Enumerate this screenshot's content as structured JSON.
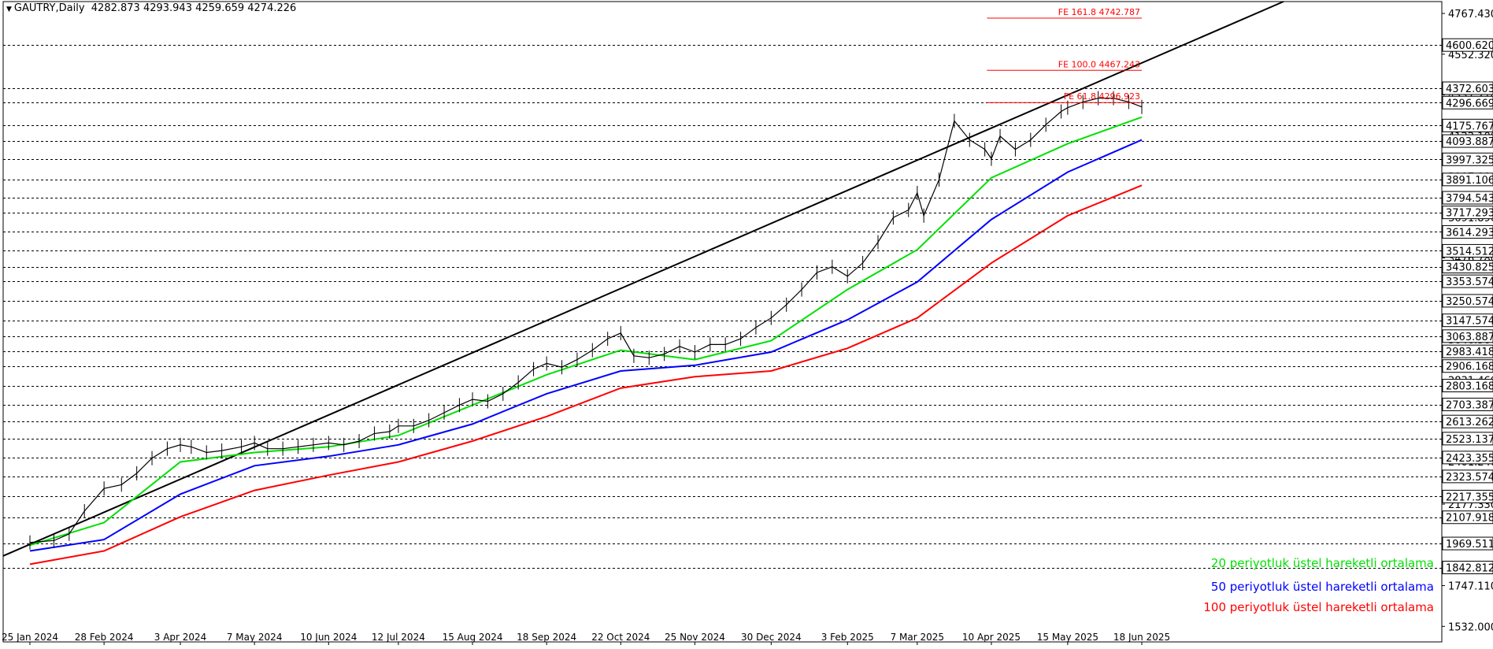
{
  "header": {
    "symbol": "GAUTRY,Daily",
    "ohlc": "4282.873 4293.943 4259.659 4274.226"
  },
  "chart_data": {
    "type": "line",
    "title": "GAUTRY,Daily",
    "ylim": [
      1450,
      4830
    ],
    "price_axis_labels": [
      "4767.430",
      "4552.320",
      "4337.210",
      "4122.100",
      "3907.000",
      "3691.890",
      "3476.780",
      "3261.670",
      "3046.560",
      "2831.460",
      "2616.350",
      "2401.240",
      "2177.330",
      "1962.020",
      "1747.110",
      "1532.000"
    ],
    "price_axis_values": [
      4767.43,
      4552.32,
      4337.21,
      4122.1,
      3907.0,
      3691.89,
      3476.78,
      3261.67,
      3046.56,
      2831.46,
      2616.35,
      2401.24,
      2177.33,
      1962.02,
      1747.11,
      1532.0
    ],
    "level_lines": [
      "4600.620",
      "4372.603",
      "4296.669",
      "4175.767",
      "4093.887",
      "3997.325",
      "3891.106",
      "3794.543",
      "3717.293",
      "3614.293",
      "3514.512",
      "3430.825",
      "3353.574",
      "3250.574",
      "3147.574",
      "3063.887",
      "2983.418",
      "2906.168",
      "2803.168",
      "2703.387",
      "2613.262",
      "2523.137",
      "2423.355",
      "2323.574",
      "2217.355",
      "2107.918",
      "1969.511",
      "1842.812"
    ],
    "level_values": [
      4600.62,
      4372.603,
      4296.669,
      4175.767,
      4093.887,
      3997.325,
      3891.106,
      3794.543,
      3717.293,
      3614.293,
      3514.512,
      3430.825,
      3353.574,
      3250.574,
      3147.574,
      3063.887,
      2983.418,
      2906.168,
      2803.168,
      2703.387,
      2613.262,
      2523.137,
      2423.355,
      2323.574,
      2217.355,
      2107.918,
      1969.511,
      1842.812
    ],
    "x_ticks": [
      "25 Jan 2024",
      "28 Feb 2024",
      "3 Apr 2024",
      "7 May 2024",
      "10 Jun 2024",
      "12 Jul 2024",
      "15 Aug 2024",
      "18 Sep 2024",
      "22 Oct 2024",
      "25 Nov 2024",
      "30 Dec 2024",
      "3 Feb 2025",
      "7 Mar 2025",
      "10 Apr 2025",
      "15 May 2025",
      "18 Jun 2025"
    ],
    "x_tick_dates": [
      "2024-01-25",
      "2024-02-28",
      "2024-04-03",
      "2024-05-07",
      "2024-06-10",
      "2024-07-12",
      "2024-08-15",
      "2024-09-18",
      "2024-10-22",
      "2024-11-25",
      "2024-12-30",
      "2025-02-03",
      "2025-03-07",
      "2025-04-10",
      "2025-05-15",
      "2025-06-18"
    ],
    "fibonacci": [
      {
        "label": "FE 161.8 4742.787",
        "value": 4742.787
      },
      {
        "label": "FE 100.0 4467.243",
        "value": 4467.243
      },
      {
        "label": "FE 61.8 4296.923",
        "value": 4296.923
      }
    ],
    "fib_start_date": "2025-04-08",
    "fib_end_date": "2025-06-18",
    "trendline": {
      "start_date": "2024-01-25",
      "start_value": 1965,
      "end_date": "2025-08-22",
      "end_value": 4830
    },
    "close_series": {
      "name": "",
      "dates": [
        "2024-01-25",
        "2024-02-05",
        "2024-02-12",
        "2024-02-19",
        "2024-02-28",
        "2024-03-07",
        "2024-03-14",
        "2024-03-21",
        "2024-03-28",
        "2024-04-03",
        "2024-04-08",
        "2024-04-15",
        "2024-04-22",
        "2024-05-01",
        "2024-05-07",
        "2024-05-13",
        "2024-05-20",
        "2024-05-27",
        "2024-06-03",
        "2024-06-10",
        "2024-06-17",
        "2024-06-24",
        "2024-07-01",
        "2024-07-08",
        "2024-07-12",
        "2024-07-19",
        "2024-07-26",
        "2024-08-02",
        "2024-08-09",
        "2024-08-15",
        "2024-08-22",
        "2024-08-29",
        "2024-09-05",
        "2024-09-12",
        "2024-09-18",
        "2024-09-25",
        "2024-10-02",
        "2024-10-09",
        "2024-10-16",
        "2024-10-22",
        "2024-10-28",
        "2024-11-04",
        "2024-11-11",
        "2024-11-18",
        "2024-11-25",
        "2024-12-02",
        "2024-12-09",
        "2024-12-16",
        "2024-12-23",
        "2024-12-30",
        "2025-01-06",
        "2025-01-13",
        "2025-01-20",
        "2025-01-27",
        "2025-02-03",
        "2025-02-10",
        "2025-02-17",
        "2025-02-24",
        "2025-03-03",
        "2025-03-07",
        "2025-03-10",
        "2025-03-17",
        "2025-03-24",
        "2025-03-31",
        "2025-04-07",
        "2025-04-10",
        "2025-04-14",
        "2025-04-21",
        "2025-04-28",
        "2025-05-05",
        "2025-05-12",
        "2025-05-15",
        "2025-05-22",
        "2025-05-29",
        "2025-06-05",
        "2025-06-12",
        "2025-06-18"
      ],
      "values": [
        1975,
        1985,
        2020,
        2140,
        2260,
        2280,
        2340,
        2420,
        2470,
        2490,
        2480,
        2450,
        2460,
        2480,
        2500,
        2470,
        2470,
        2480,
        2490,
        2500,
        2490,
        2510,
        2550,
        2560,
        2590,
        2590,
        2620,
        2660,
        2700,
        2730,
        2720,
        2760,
        2820,
        2890,
        2920,
        2900,
        2940,
        2990,
        3050,
        3080,
        2960,
        2950,
        2970,
        3010,
        2980,
        3020,
        3020,
        3050,
        3110,
        3160,
        3230,
        3310,
        3400,
        3430,
        3380,
        3450,
        3560,
        3690,
        3730,
        3820,
        3700,
        3890,
        4200,
        4100,
        4050,
        4000,
        4120,
        4050,
        4100,
        4180,
        4250,
        4270,
        4300,
        4320,
        4320,
        4300,
        4274
      ]
    },
    "series": [
      {
        "name": "20 periyotluk üstel hareketli ortalama",
        "color": "#00e000",
        "dates": [
          "2024-01-25",
          "2024-02-28",
          "2024-04-03",
          "2024-05-07",
          "2024-06-10",
          "2024-07-12",
          "2024-08-15",
          "2024-09-18",
          "2024-10-22",
          "2024-11-25",
          "2024-12-30",
          "2025-02-03",
          "2025-03-07",
          "2025-04-10",
          "2025-05-15",
          "2025-06-18"
        ],
        "values": [
          1960,
          2080,
          2400,
          2450,
          2480,
          2540,
          2700,
          2860,
          2990,
          2940,
          3040,
          3310,
          3520,
          3900,
          4080,
          4220
        ]
      },
      {
        "name": "50 periyotluk üstel hareketli ortalama",
        "color": "#0000ff",
        "dates": [
          "2024-01-25",
          "2024-02-28",
          "2024-04-03",
          "2024-05-07",
          "2024-06-10",
          "2024-07-12",
          "2024-08-15",
          "2024-09-18",
          "2024-10-22",
          "2024-11-25",
          "2024-12-30",
          "2025-02-03",
          "2025-03-07",
          "2025-04-10",
          "2025-05-15",
          "2025-06-18"
        ],
        "values": [
          1930,
          1990,
          2230,
          2380,
          2430,
          2490,
          2600,
          2760,
          2880,
          2910,
          2980,
          3150,
          3350,
          3680,
          3930,
          4100
        ]
      },
      {
        "name": "100 periyotluk üstel hareketli ortalama",
        "color": "#ff0000",
        "dates": [
          "2024-01-25",
          "2024-02-28",
          "2024-04-03",
          "2024-05-07",
          "2024-06-10",
          "2024-07-12",
          "2024-08-15",
          "2024-09-18",
          "2024-10-22",
          "2024-11-25",
          "2024-12-30",
          "2025-02-03",
          "2025-03-07",
          "2025-04-10",
          "2025-05-15",
          "2025-06-18"
        ],
        "values": [
          1860,
          1930,
          2110,
          2250,
          2330,
          2400,
          2510,
          2640,
          2790,
          2850,
          2880,
          3000,
          3160,
          3450,
          3700,
          3860
        ]
      }
    ],
    "legend_placement": "bottom-right",
    "grid": false
  }
}
